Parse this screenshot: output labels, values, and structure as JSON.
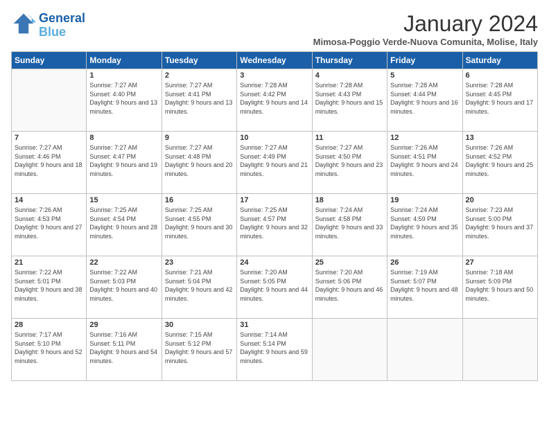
{
  "header": {
    "logo_line1": "General",
    "logo_line2": "Blue",
    "month_title": "January 2024",
    "subtitle": "Mimosa-Poggio Verde-Nuova Comunita, Molise, Italy"
  },
  "days_of_week": [
    "Sunday",
    "Monday",
    "Tuesday",
    "Wednesday",
    "Thursday",
    "Friday",
    "Saturday"
  ],
  "weeks": [
    [
      {
        "num": "",
        "sunrise": "",
        "sunset": "",
        "daylight": ""
      },
      {
        "num": "1",
        "sunrise": "Sunrise: 7:27 AM",
        "sunset": "Sunset: 4:40 PM",
        "daylight": "Daylight: 9 hours and 13 minutes."
      },
      {
        "num": "2",
        "sunrise": "Sunrise: 7:27 AM",
        "sunset": "Sunset: 4:41 PM",
        "daylight": "Daylight: 9 hours and 13 minutes."
      },
      {
        "num": "3",
        "sunrise": "Sunrise: 7:28 AM",
        "sunset": "Sunset: 4:42 PM",
        "daylight": "Daylight: 9 hours and 14 minutes."
      },
      {
        "num": "4",
        "sunrise": "Sunrise: 7:28 AM",
        "sunset": "Sunset: 4:43 PM",
        "daylight": "Daylight: 9 hours and 15 minutes."
      },
      {
        "num": "5",
        "sunrise": "Sunrise: 7:28 AM",
        "sunset": "Sunset: 4:44 PM",
        "daylight": "Daylight: 9 hours and 16 minutes."
      },
      {
        "num": "6",
        "sunrise": "Sunrise: 7:28 AM",
        "sunset": "Sunset: 4:45 PM",
        "daylight": "Daylight: 9 hours and 17 minutes."
      }
    ],
    [
      {
        "num": "7",
        "sunrise": "Sunrise: 7:27 AM",
        "sunset": "Sunset: 4:46 PM",
        "daylight": "Daylight: 9 hours and 18 minutes."
      },
      {
        "num": "8",
        "sunrise": "Sunrise: 7:27 AM",
        "sunset": "Sunset: 4:47 PM",
        "daylight": "Daylight: 9 hours and 19 minutes."
      },
      {
        "num": "9",
        "sunrise": "Sunrise: 7:27 AM",
        "sunset": "Sunset: 4:48 PM",
        "daylight": "Daylight: 9 hours and 20 minutes."
      },
      {
        "num": "10",
        "sunrise": "Sunrise: 7:27 AM",
        "sunset": "Sunset: 4:49 PM",
        "daylight": "Daylight: 9 hours and 21 minutes."
      },
      {
        "num": "11",
        "sunrise": "Sunrise: 7:27 AM",
        "sunset": "Sunset: 4:50 PM",
        "daylight": "Daylight: 9 hours and 23 minutes."
      },
      {
        "num": "12",
        "sunrise": "Sunrise: 7:26 AM",
        "sunset": "Sunset: 4:51 PM",
        "daylight": "Daylight: 9 hours and 24 minutes."
      },
      {
        "num": "13",
        "sunrise": "Sunrise: 7:26 AM",
        "sunset": "Sunset: 4:52 PM",
        "daylight": "Daylight: 9 hours and 25 minutes."
      }
    ],
    [
      {
        "num": "14",
        "sunrise": "Sunrise: 7:26 AM",
        "sunset": "Sunset: 4:53 PM",
        "daylight": "Daylight: 9 hours and 27 minutes."
      },
      {
        "num": "15",
        "sunrise": "Sunrise: 7:25 AM",
        "sunset": "Sunset: 4:54 PM",
        "daylight": "Daylight: 9 hours and 28 minutes."
      },
      {
        "num": "16",
        "sunrise": "Sunrise: 7:25 AM",
        "sunset": "Sunset: 4:55 PM",
        "daylight": "Daylight: 9 hours and 30 minutes."
      },
      {
        "num": "17",
        "sunrise": "Sunrise: 7:25 AM",
        "sunset": "Sunset: 4:57 PM",
        "daylight": "Daylight: 9 hours and 32 minutes."
      },
      {
        "num": "18",
        "sunrise": "Sunrise: 7:24 AM",
        "sunset": "Sunset: 4:58 PM",
        "daylight": "Daylight: 9 hours and 33 minutes."
      },
      {
        "num": "19",
        "sunrise": "Sunrise: 7:24 AM",
        "sunset": "Sunset: 4:59 PM",
        "daylight": "Daylight: 9 hours and 35 minutes."
      },
      {
        "num": "20",
        "sunrise": "Sunrise: 7:23 AM",
        "sunset": "Sunset: 5:00 PM",
        "daylight": "Daylight: 9 hours and 37 minutes."
      }
    ],
    [
      {
        "num": "21",
        "sunrise": "Sunrise: 7:22 AM",
        "sunset": "Sunset: 5:01 PM",
        "daylight": "Daylight: 9 hours and 38 minutes."
      },
      {
        "num": "22",
        "sunrise": "Sunrise: 7:22 AM",
        "sunset": "Sunset: 5:03 PM",
        "daylight": "Daylight: 9 hours and 40 minutes."
      },
      {
        "num": "23",
        "sunrise": "Sunrise: 7:21 AM",
        "sunset": "Sunset: 5:04 PM",
        "daylight": "Daylight: 9 hours and 42 minutes."
      },
      {
        "num": "24",
        "sunrise": "Sunrise: 7:20 AM",
        "sunset": "Sunset: 5:05 PM",
        "daylight": "Daylight: 9 hours and 44 minutes."
      },
      {
        "num": "25",
        "sunrise": "Sunrise: 7:20 AM",
        "sunset": "Sunset: 5:06 PM",
        "daylight": "Daylight: 9 hours and 46 minutes."
      },
      {
        "num": "26",
        "sunrise": "Sunrise: 7:19 AM",
        "sunset": "Sunset: 5:07 PM",
        "daylight": "Daylight: 9 hours and 48 minutes."
      },
      {
        "num": "27",
        "sunrise": "Sunrise: 7:18 AM",
        "sunset": "Sunset: 5:09 PM",
        "daylight": "Daylight: 9 hours and 50 minutes."
      }
    ],
    [
      {
        "num": "28",
        "sunrise": "Sunrise: 7:17 AM",
        "sunset": "Sunset: 5:10 PM",
        "daylight": "Daylight: 9 hours and 52 minutes."
      },
      {
        "num": "29",
        "sunrise": "Sunrise: 7:16 AM",
        "sunset": "Sunset: 5:11 PM",
        "daylight": "Daylight: 9 hours and 54 minutes."
      },
      {
        "num": "30",
        "sunrise": "Sunrise: 7:15 AM",
        "sunset": "Sunset: 5:12 PM",
        "daylight": "Daylight: 9 hours and 57 minutes."
      },
      {
        "num": "31",
        "sunrise": "Sunrise: 7:14 AM",
        "sunset": "Sunset: 5:14 PM",
        "daylight": "Daylight: 9 hours and 59 minutes."
      },
      {
        "num": "",
        "sunrise": "",
        "sunset": "",
        "daylight": ""
      },
      {
        "num": "",
        "sunrise": "",
        "sunset": "",
        "daylight": ""
      },
      {
        "num": "",
        "sunrise": "",
        "sunset": "",
        "daylight": ""
      }
    ]
  ]
}
